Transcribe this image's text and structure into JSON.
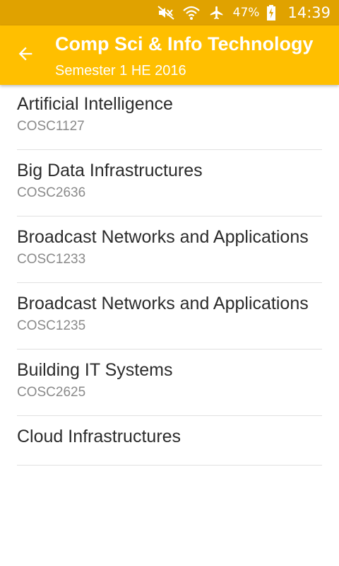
{
  "status_bar": {
    "icons": [
      "mute-icon",
      "wifi-icon",
      "airplane-icon"
    ],
    "battery": "47%",
    "time": "14:39"
  },
  "app_bar": {
    "title": "Comp Sci & Info Technology",
    "subtitle": "Semester 1 HE 2016",
    "back_icon": "arrow-back-icon",
    "color": "#ffbf00",
    "status_color": "#e0a200"
  },
  "courses": [
    {
      "name": "Artificial Intelligence",
      "code": "COSC1127"
    },
    {
      "name": "Big Data Infrastructures",
      "code": "COSC2636"
    },
    {
      "name": "Broadcast Networks and Applications",
      "code": "COSC1233"
    },
    {
      "name": "Broadcast Networks and Applications",
      "code": "COSC1235"
    },
    {
      "name": "Building IT Systems",
      "code": "COSC2625"
    },
    {
      "name": "Cloud Infrastructures",
      "code": ""
    }
  ]
}
